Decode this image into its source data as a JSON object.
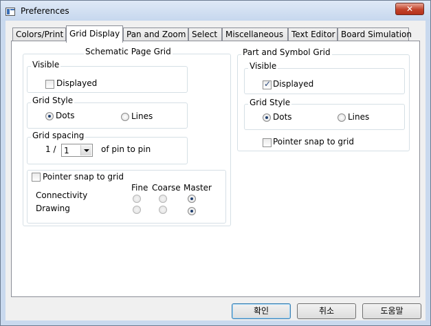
{
  "window": {
    "title": "Preferences",
    "close_glyph": "✕"
  },
  "tabs": [
    "Colors/Print",
    "Grid Display",
    "Pan and Zoom",
    "Select",
    "Miscellaneous",
    "Text Editor",
    "Board Simulation"
  ],
  "active_tab": "Grid Display",
  "schematic": {
    "title": "Schematic Page Grid",
    "visible": {
      "label": "Visible",
      "displayed_label": "Displayed",
      "displayed_checked": false
    },
    "grid_style": {
      "label": "Grid Style",
      "dots_label": "Dots",
      "lines_label": "Lines",
      "selected": "Dots"
    },
    "grid_spacing": {
      "label": "Grid spacing",
      "prefix": "1 /",
      "value": "1",
      "suffix": "of pin to pin"
    },
    "snap": {
      "label": "Pointer snap to grid",
      "checked": false,
      "columns": [
        "Fine",
        "Coarse",
        "Master"
      ],
      "rows": [
        {
          "label": "Connectivity",
          "selected": "Master"
        },
        {
          "label": "Drawing",
          "selected": "Master"
        }
      ]
    }
  },
  "part_symbol": {
    "title": "Part and Symbol Grid",
    "visible": {
      "label": "Visible",
      "displayed_label": "Displayed",
      "displayed_checked": true
    },
    "grid_style": {
      "label": "Grid Style",
      "dots_label": "Dots",
      "lines_label": "Lines",
      "selected": "Dots"
    },
    "snap": {
      "label": "Pointer snap to grid",
      "checked": false
    }
  },
  "buttons": {
    "ok": "확인",
    "cancel": "취소",
    "help": "도움말"
  }
}
